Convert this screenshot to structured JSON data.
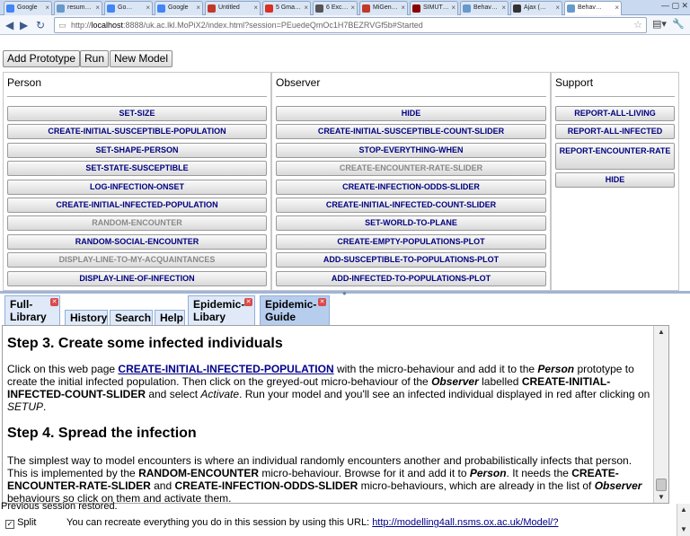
{
  "browser": {
    "tabs": [
      {
        "title": "Google",
        "color": "#4285f4"
      },
      {
        "title": "resum…",
        "color": "#6699cc"
      },
      {
        "title": "Go…",
        "color": "#4285f4"
      },
      {
        "title": "Google",
        "color": "#4285f4"
      },
      {
        "title": "Untitled",
        "color": "#c0392b"
      },
      {
        "title": "5 Gma…",
        "color": "#d93025"
      },
      {
        "title": "6 Exc…",
        "color": "#555555"
      },
      {
        "title": "MiGen…",
        "color": "#c0392b"
      },
      {
        "title": "SIMUT…",
        "color": "#8b0000"
      },
      {
        "title": "Behav…",
        "color": "#6699cc"
      },
      {
        "title": "Ajax (…",
        "color": "#333333"
      },
      {
        "title": "Behav…",
        "color": "#6699cc"
      }
    ],
    "url_prefix": "http://",
    "url_host": "localhost",
    "url_rest": ":8888/uk.ac.lkl.MoPiX2/index.html?session=PEuedeQmOc1H7BEZRVGf5b#Started"
  },
  "toolbar": {
    "add_prototype": "Add Prototype",
    "run": "Run",
    "new_model": "New Model"
  },
  "panels": {
    "person": {
      "title": "Person",
      "buttons": [
        {
          "label": "SET-SIZE",
          "grey": false
        },
        {
          "label": "CREATE-INITIAL-SUSCEPTIBLE-POPULATION",
          "grey": false
        },
        {
          "label": "SET-SHAPE-PERSON",
          "grey": false
        },
        {
          "label": "SET-STATE-SUSCEPTIBLE",
          "grey": false
        },
        {
          "label": "LOG-INFECTION-ONSET",
          "grey": false
        },
        {
          "label": "CREATE-INITIAL-INFECTED-POPULATION",
          "grey": false
        },
        {
          "label": "RANDOM-ENCOUNTER",
          "grey": true
        },
        {
          "label": "RANDOM-SOCIAL-ENCOUNTER",
          "grey": false
        },
        {
          "label": "DISPLAY-LINE-TO-MY-ACQUAINTANCES",
          "grey": true
        },
        {
          "label": "DISPLAY-LINE-OF-INFECTION",
          "grey": false
        }
      ]
    },
    "observer": {
      "title": "Observer",
      "buttons": [
        {
          "label": "HIDE",
          "grey": false
        },
        {
          "label": "CREATE-INITIAL-SUSCEPTIBLE-COUNT-SLIDER",
          "grey": false
        },
        {
          "label": "STOP-EVERYTHING-WHEN",
          "grey": false
        },
        {
          "label": "CREATE-ENCOUNTER-RATE-SLIDER",
          "grey": true
        },
        {
          "label": "CREATE-INFECTION-ODDS-SLIDER",
          "grey": false
        },
        {
          "label": "CREATE-INITIAL-INFECTED-COUNT-SLIDER",
          "grey": false
        },
        {
          "label": "SET-WORLD-TO-PLANE",
          "grey": false
        },
        {
          "label": "CREATE-EMPTY-POPULATIONS-PLOT",
          "grey": false
        },
        {
          "label": "ADD-SUSCEPTIBLE-TO-POPULATIONS-PLOT",
          "grey": false
        },
        {
          "label": "ADD-INFECTED-TO-POPULATIONS-PLOT",
          "grey": false
        }
      ]
    },
    "support": {
      "title": "Support",
      "buttons": [
        {
          "label": "REPORT-ALL-LIVING"
        },
        {
          "label": "REPORT-ALL-INFECTED"
        },
        {
          "label": "REPORT-ENCOUNTER-RATE"
        },
        {
          "label": "HIDE"
        }
      ]
    }
  },
  "tabs": {
    "full_library": "Full-\nLibrary",
    "history": "History",
    "search": "Search",
    "help": "Help",
    "epidemic_library": "Epidemic-\nLibary",
    "epidemic_guide": "Epidemic-\nGuide"
  },
  "guide": {
    "step3_title": "Step 3. Create some infected individuals",
    "s3_t1": "Click on this web page ",
    "s3_link": "CREATE-INITIAL-INFECTED-POPULATION",
    "s3_t2": " with the micro-behaviour and add it to the ",
    "s3_person": "Person",
    "s3_t3": " prototype to create the initial infected population. Then click on the greyed-out micro-behaviour of the ",
    "s3_observer": "Observer",
    "s3_t4": " labelled ",
    "s3_slider": "CREATE-INITIAL-INFECTED-COUNT-SLIDER",
    "s3_t5": " and select ",
    "s3_activate": "Activate",
    "s3_t6": ". Run your model and you'll see an infected individual displayed in red after clicking on ",
    "s3_setup": "SETUP",
    "s3_t7": ".",
    "step4_title": "Step 4. Spread the infection",
    "s4_t1": "The simplest way to model encounters is where an individual randomly encounters another and probabilistically infects that person. This is implemented by the ",
    "s4_re": "RANDOM-ENCOUNTER",
    "s4_t2": " micro-behaviour. Browse for it and add it to ",
    "s4_person": "Person",
    "s4_t3": ". It needs the ",
    "s4_cers": "CREATE-ENCOUNTER-RATE-SLIDER",
    "s4_t4": " and ",
    "s4_cios": "CREATE-INFECTION-ODDS-SLIDER",
    "s4_t5": " micro-behaviours, which are already in the list of ",
    "s4_observer": "Observer",
    "s4_t6": " behaviours so click on them and activate them."
  },
  "status": {
    "message": "Previous session restored.",
    "split_label": "Split",
    "url_text": "You can recreate everything you do in this session by using this URL: ",
    "url_link": "http://modelling4all.nsms.ox.ac.uk/Model/?"
  }
}
